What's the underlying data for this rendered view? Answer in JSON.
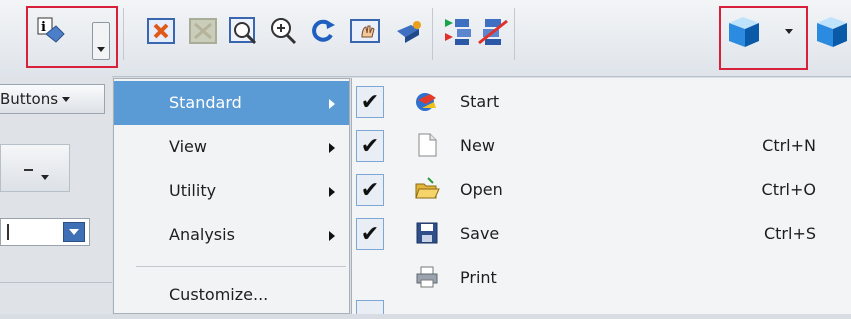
{
  "toolbar": {
    "icons": [
      "info-tag-icon",
      "fit-view-icon",
      "zoom-window-disabled-icon",
      "zoom-area-icon",
      "zoom-in-icon",
      "rotate-icon",
      "pan-icon",
      "perspective-icon",
      "assembly-colored-icon",
      "assembly-red-icon",
      "shaded-cube-icon",
      "shaded-cube-icon"
    ]
  },
  "left": {
    "buttons_dropdown_label": "Buttons"
  },
  "submenu": {
    "items": [
      {
        "label": "Standard",
        "selected": true
      },
      {
        "label": "View"
      },
      {
        "label": "Utility"
      },
      {
        "label": "Analysis"
      }
    ],
    "customize_label": "Customize..."
  },
  "standard_menu": {
    "items": [
      {
        "label": "Start",
        "shortcut": "",
        "checked": true,
        "icon": "start-icon"
      },
      {
        "label": "New",
        "shortcut": "Ctrl+N",
        "checked": true,
        "icon": "new-document-icon"
      },
      {
        "label": "Open",
        "shortcut": "Ctrl+O",
        "checked": true,
        "icon": "open-folder-icon"
      },
      {
        "label": "Save",
        "shortcut": "Ctrl+S",
        "checked": true,
        "icon": "save-disk-icon"
      },
      {
        "label": "Print",
        "shortcut": "",
        "checked": false,
        "icon": "printer-icon"
      }
    ]
  },
  "colors": {
    "highlight": "#5b9bd5",
    "callout": "#d9203a",
    "accent_blue": "#3f6fb5"
  }
}
